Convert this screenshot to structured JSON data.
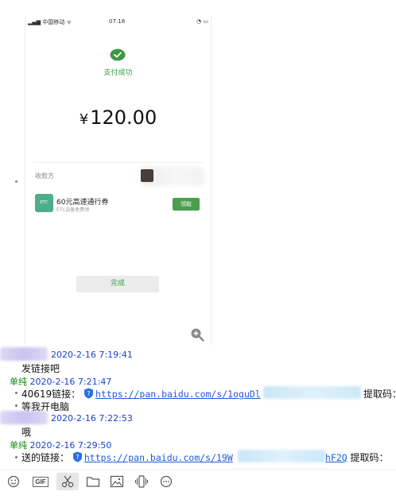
{
  "phone_screenshot": {
    "status_bar": {
      "carrier": "中国移动",
      "time": "07:18"
    },
    "payment_status": "支付成功",
    "amount_currency": "¥",
    "amount_value": "120.00",
    "payee_label": "收款方",
    "coupon": {
      "logo_text": "ETC",
      "title": "60元高速通行券",
      "subtitle": "ETC设备免费领",
      "button": "领取"
    },
    "done_button": "完成",
    "colors": {
      "wechat_green": "#3c9a45",
      "coupon_button": "#4a9e4f"
    }
  },
  "chat": {
    "messages": [
      {
        "sender": "",
        "timestamp": "2020-2-16 7:19:41",
        "lines": [
          "发链接吧"
        ]
      },
      {
        "sender": "单纯",
        "timestamp": "2020-2-16 7:21:47",
        "lines": [
          {
            "prefix": "40619链接：",
            "url": "https://pan.baidu.com/s/1oguDl",
            "suffix": "提取码："
          },
          {
            "text": "等我开电脑"
          }
        ]
      },
      {
        "sender": "",
        "timestamp": "2020-2-16 7:22:53",
        "lines": [
          "哦"
        ]
      },
      {
        "sender": "单纯",
        "timestamp": "2020-2-16 7:29:50",
        "lines": [
          {
            "prefix": "送的链接：",
            "url": "https://pan.baidu.com/s/19W",
            "url_tail": "hF2Q",
            "suffix": "提取码："
          }
        ]
      }
    ],
    "colors": {
      "sender_name": "#118811",
      "timestamp": "#1a3fcf",
      "link": "#1a5cd6"
    }
  },
  "toolbar": {
    "icons": [
      "emoji-icon",
      "gif-icon",
      "scissors-icon",
      "folder-icon",
      "image-icon",
      "shake-icon",
      "more-icon"
    ],
    "gif_label": "GIF"
  }
}
